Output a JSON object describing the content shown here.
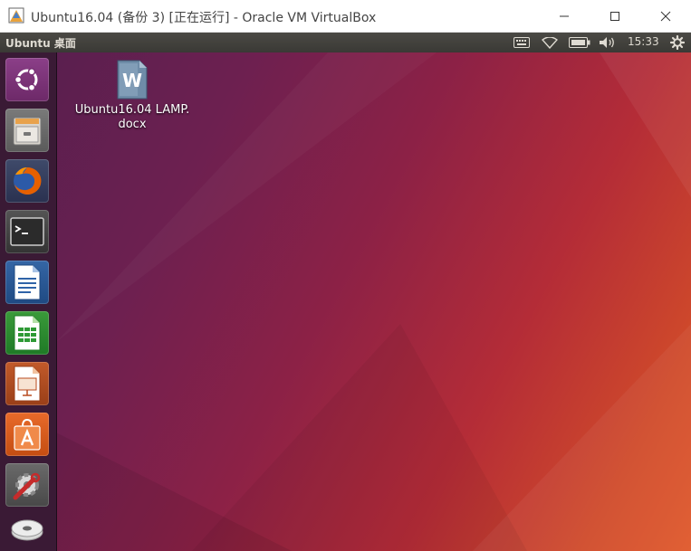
{
  "window": {
    "title": "Ubuntu16.04 (备份 3) [正在运行] - Oracle VM VirtualBox",
    "controls": [
      "minimize",
      "maximize",
      "close"
    ]
  },
  "panel": {
    "title": "Ubuntu 桌面",
    "clock": "15:33",
    "indicators": [
      "keyboard-icon",
      "wifi-icon",
      "battery-icon",
      "volume-icon",
      "gear-icon"
    ]
  },
  "launcher": {
    "items": [
      {
        "name": "dash",
        "icon": "ubuntu-logo-icon"
      },
      {
        "name": "files",
        "icon": "file-cabinet-icon"
      },
      {
        "name": "firefox",
        "icon": "firefox-icon"
      },
      {
        "name": "terminal",
        "icon": "terminal-icon"
      },
      {
        "name": "libreoffice-writer",
        "icon": "writer-icon"
      },
      {
        "name": "libreoffice-calc",
        "icon": "calc-icon"
      },
      {
        "name": "libreoffice-impress",
        "icon": "impress-icon"
      },
      {
        "name": "software-center",
        "icon": "shopping-bag-icon"
      },
      {
        "name": "system-settings",
        "icon": "settings-wrench-icon"
      },
      {
        "name": "disk",
        "icon": "disc-icon"
      }
    ]
  },
  "desktop": {
    "icons": [
      {
        "label_line1": "Ubuntu16.04 LAMP.",
        "label_line2": "docx",
        "icon": "word-document-icon"
      }
    ]
  },
  "colors": {
    "panel_bg": "#3c3b37",
    "launcher_bg": "#3a1a35",
    "desktop_start": "#5a1f4f",
    "desktop_end": "#e0582a"
  }
}
